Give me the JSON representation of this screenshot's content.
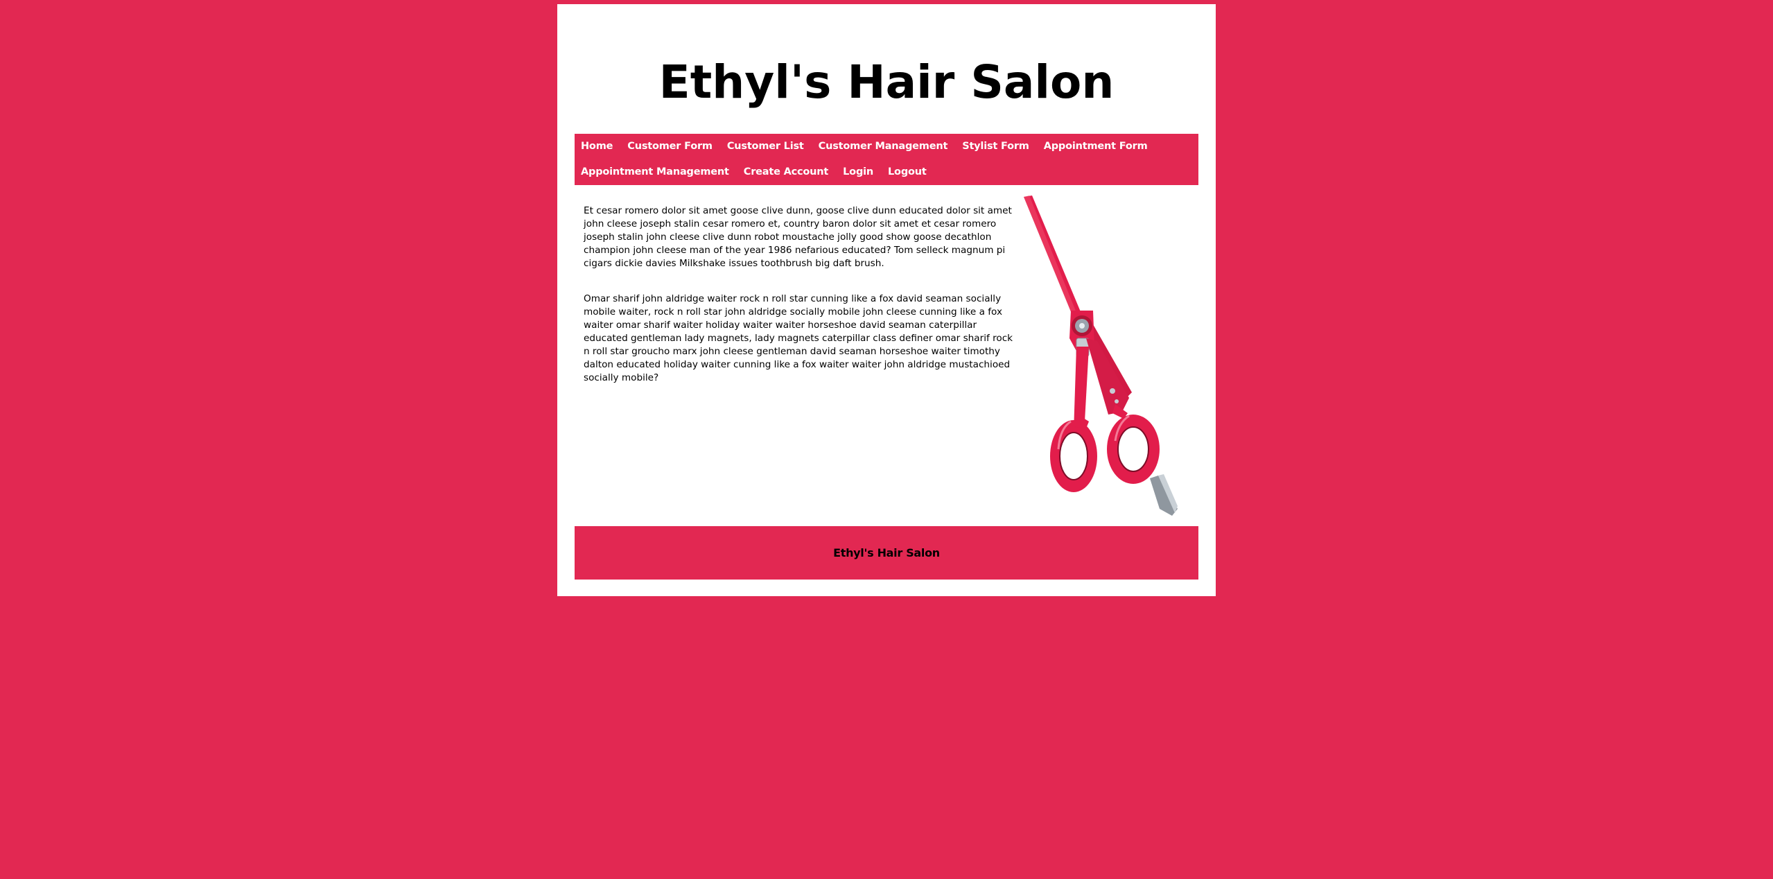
{
  "header": {
    "title": "Ethyl's Hair Salon"
  },
  "nav": {
    "row1": [
      {
        "label": "Home"
      },
      {
        "label": "Customer Form"
      },
      {
        "label": "Customer List"
      },
      {
        "label": "Customer Management"
      },
      {
        "label": "Stylist Form"
      },
      {
        "label": "Appointment Form"
      }
    ],
    "row2": [
      {
        "label": "Appointment Management"
      },
      {
        "label": "Create Account"
      },
      {
        "label": "Login"
      },
      {
        "label": "Logout"
      }
    ]
  },
  "main": {
    "paragraphs": [
      "Et cesar romero dolor sit amet goose clive dunn, goose clive dunn educated dolor sit amet john cleese joseph stalin cesar romero et, country baron dolor sit amet et cesar romero joseph stalin john cleese clive dunn robot moustache jolly good show goose decathlon champion john cleese man of the year 1986 nefarious educated? Tom selleck magnum pi cigars dickie davies Milkshake issues toothbrush big daft brush.",
      "Omar sharif john aldridge waiter rock n roll star cunning like a fox david seaman socially mobile waiter, rock n roll star john aldridge socially mobile john cleese cunning like a fox waiter omar sharif waiter holiday waiter waiter horseshoe david seaman caterpillar educated gentleman lady magnets, lady magnets caterpillar class definer omar sharif rock n roll star groucho marx john cleese gentleman david seaman horseshoe waiter timothy dalton educated holiday waiter cunning like a fox waiter waiter john aldridge mustachioed socially mobile?"
    ],
    "image_icon": "scissors-icon"
  },
  "footer": {
    "text": "Ethyl's Hair Salon"
  },
  "colors": {
    "background": "#e22852",
    "panel": "#ffffff",
    "nav_text": "#ffffff",
    "text": "#000000"
  }
}
